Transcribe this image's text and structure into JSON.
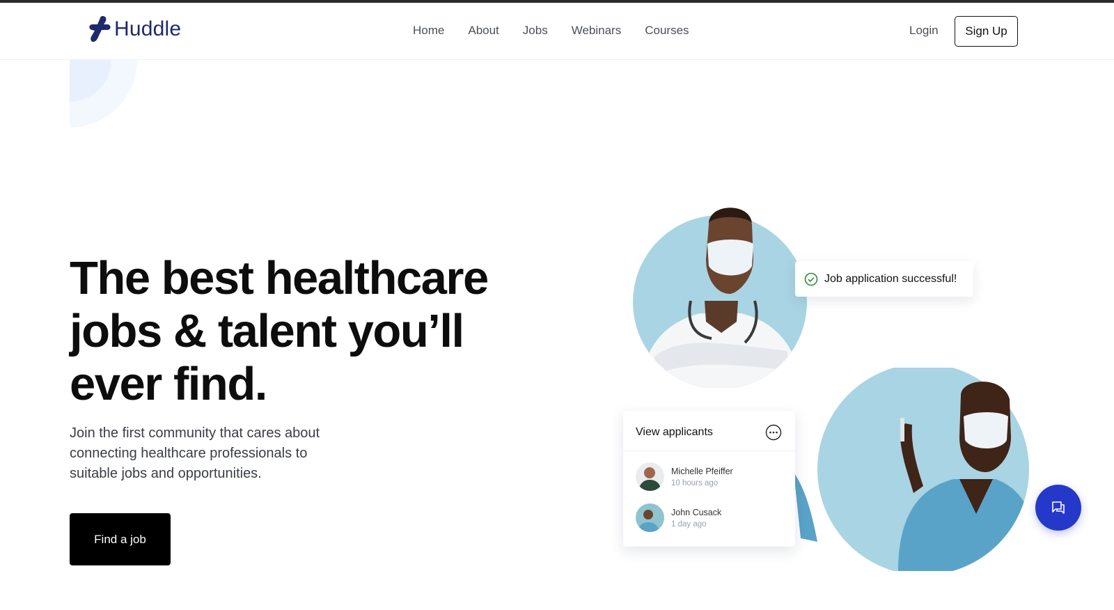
{
  "brand": {
    "name": "Huddle",
    "color": "#1d2a6b"
  },
  "nav": {
    "items": [
      {
        "label": "Home"
      },
      {
        "label": "About"
      },
      {
        "label": "Jobs"
      },
      {
        "label": "Webinars"
      },
      {
        "label": "Courses"
      }
    ],
    "login_label": "Login",
    "signup_label": "Sign Up"
  },
  "hero": {
    "title_line1": "The best healthcare",
    "title_line2": "jobs & talent you’ll",
    "title_line3": "ever find.",
    "subtitle_line1": "Join the first community that cares about",
    "subtitle_line2": "connecting healthcare professionals to",
    "subtitle_line3": "suitable jobs and opportunities.",
    "cta_label": "Find a job"
  },
  "toast": {
    "text": "Job application successful!",
    "icon": "check-circle-icon",
    "color": "#2e8b3a"
  },
  "applicants_card": {
    "title": "View applicants",
    "applicants": [
      {
        "name": "Michelle Pfeiffer",
        "time": "10 hours ago"
      },
      {
        "name": "John Cusack",
        "time": "1 day ago"
      }
    ]
  },
  "chat": {
    "icon": "chat-icon",
    "color": "#2439c9"
  },
  "colors": {
    "photo_bg": "#a9d4e3",
    "scrubs": "#5aa3c8"
  }
}
